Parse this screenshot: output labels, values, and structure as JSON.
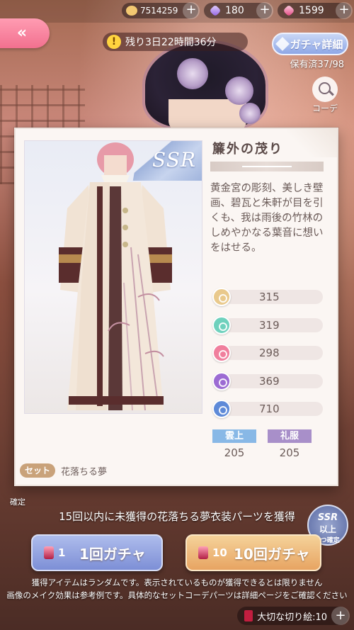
{
  "currencies": [
    {
      "icon": "cat-coin-icon",
      "value": "7514259"
    },
    {
      "icon": "purple-diamond-icon",
      "value": "180"
    },
    {
      "icon": "pink-diamond-icon",
      "value": "1599"
    }
  ],
  "header": {
    "back_label": "«",
    "timer": "残り3日22時間36分",
    "timer_icon": "!",
    "gacha_detail": "ガチャ詳細",
    "owned": "保有済37/98",
    "coordinate": "コーデ"
  },
  "card": {
    "ssr": "SSR",
    "title": "簾外の茂り",
    "description": "黄金宮の彫刻、美しき壁画、碧瓦と朱軒が目を引くも、我は雨後の竹林のしめやかなる葉音に想いをはせる。",
    "stats": [
      {
        "icon": "gorgeous-icon",
        "value": "315",
        "color": "#e9c98c"
      },
      {
        "icon": "elegant-icon",
        "value": "319",
        "color": "#6fd1bd"
      },
      {
        "icon": "cute-icon",
        "value": "298",
        "color": "#f07f9d"
      },
      {
        "icon": "sexy-icon",
        "value": "369",
        "color": "#9c6bd3"
      },
      {
        "icon": "cool-icon",
        "value": "710",
        "color": "#5e8ad8"
      }
    ],
    "tags": [
      {
        "label": "雲上",
        "value": "205",
        "color": "#88b8e6"
      },
      {
        "label": "礼服",
        "value": "205",
        "color": "#a88fc9"
      }
    ],
    "set_badge": "セット",
    "set_name": "花落ちる夢"
  },
  "bottom": {
    "confirm_left": "確定",
    "info": "15回以内に未獲得の花落ちる夢衣装パーツを獲得",
    "ssr_badge": {
      "l1": "SSR",
      "l2": "以上",
      "l3": "1つ確定"
    },
    "pull_one": {
      "cost": "1",
      "label": "1回ガチャ"
    },
    "pull_ten": {
      "cost": "10",
      "label": "10回ガチャ"
    },
    "notice_1": "獲得アイテムはランダムです。表示されているものが獲得できるとは限りません",
    "notice_2": "画像のメイク効果は参考例です。具体的なセットコーデパーツは詳細ページをご確認ください",
    "ticket": "大切な切り絵:10"
  }
}
